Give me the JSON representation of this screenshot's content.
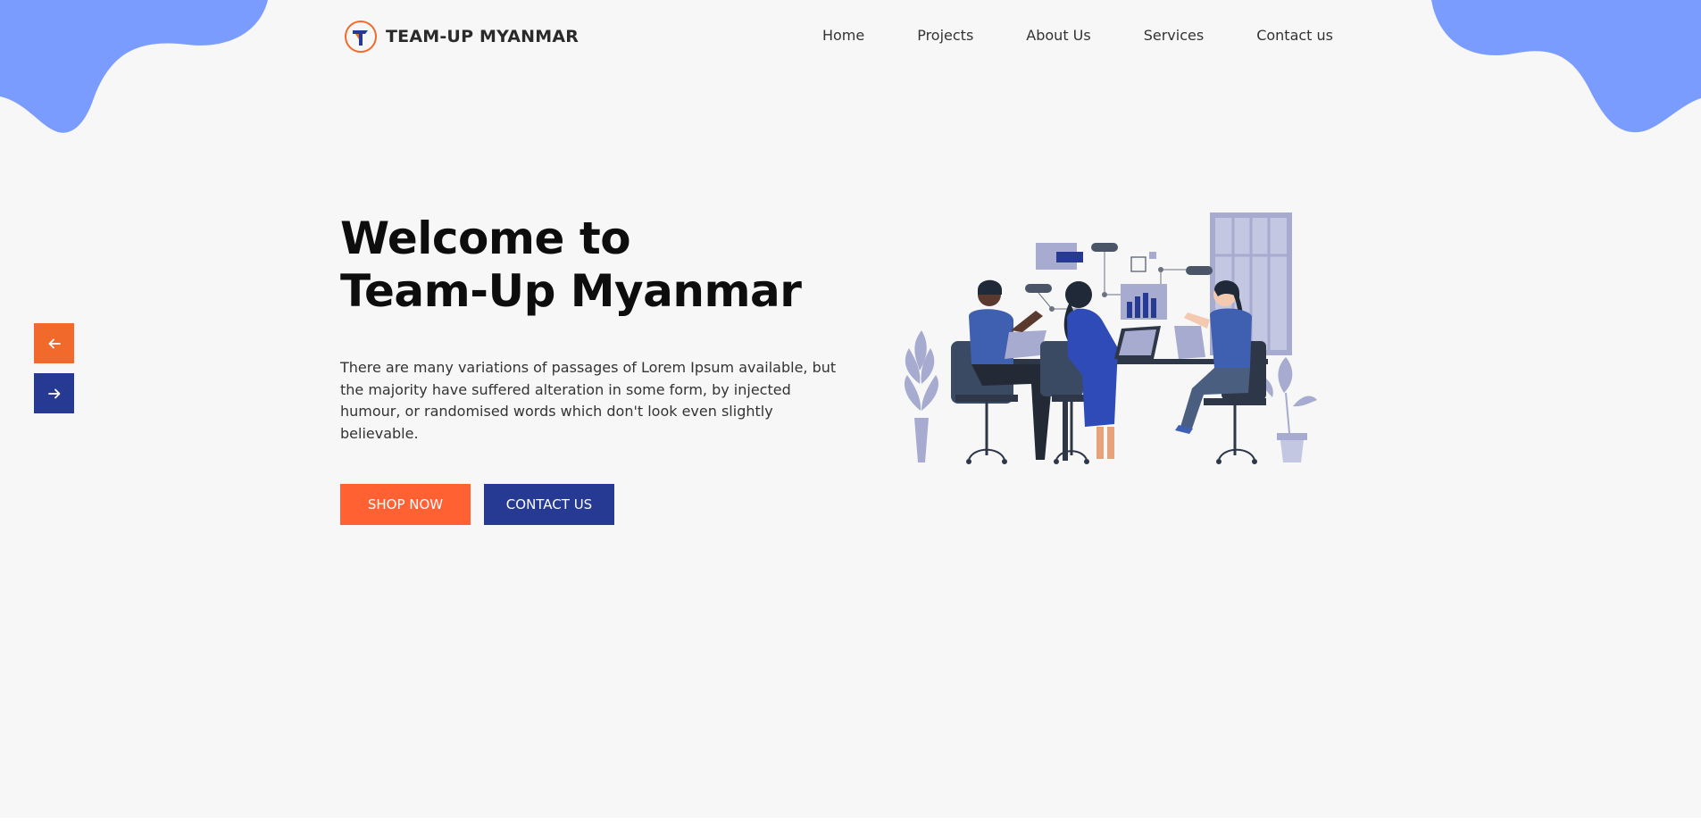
{
  "header": {
    "brand": "TEAM-UP MYANMAR",
    "nav": [
      {
        "label": "Home"
      },
      {
        "label": "Projects"
      },
      {
        "label": "About Us"
      },
      {
        "label": "Services"
      },
      {
        "label": "Contact us"
      }
    ]
  },
  "hero": {
    "title_line1": "Welcome to",
    "title_line2": "Team-Up Myanmar",
    "description": "There are many variations of passages of Lorem Ipsum available, but the majority have suffered alteration in some form, by injected humour, or randomised words which don't look even slightly believable.",
    "shop_label": "SHOP NOW",
    "contact_label": "CONTACT US"
  },
  "slider": {
    "prev_icon": "arrow-left-icon",
    "next_icon": "arrow-right-icon"
  },
  "colors": {
    "background": "#f7f7f7",
    "blob": "#7b9cff",
    "orange": "#ff6133",
    "navy": "#263a94"
  }
}
